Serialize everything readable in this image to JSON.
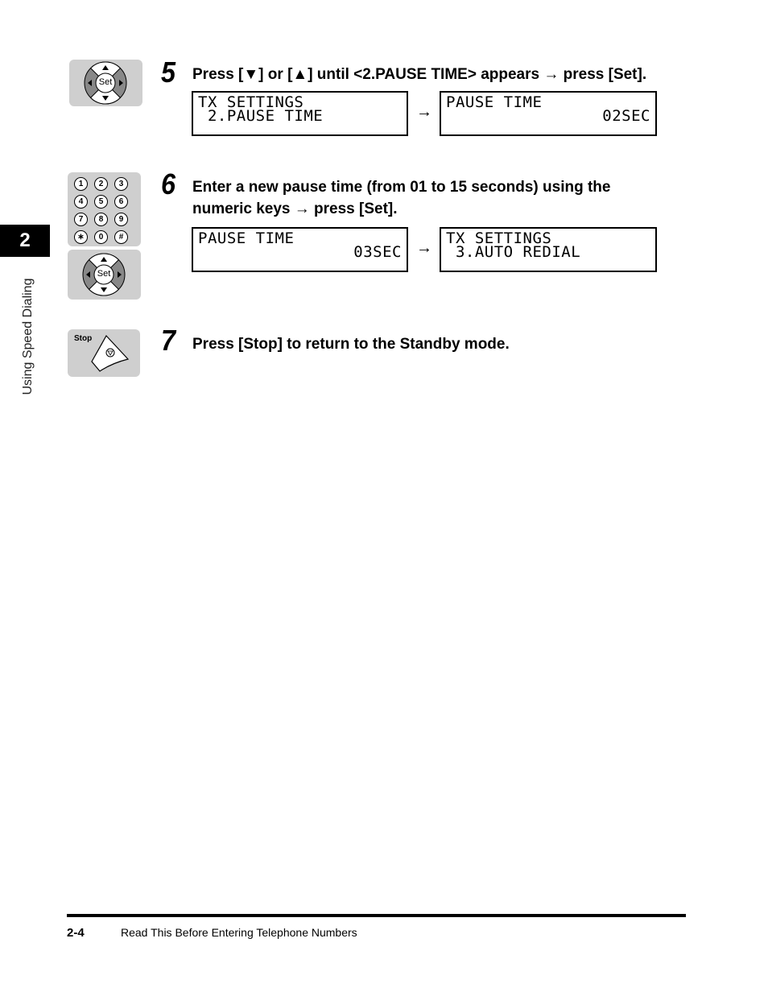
{
  "sidebar": {
    "chapter_number": "2",
    "chapter_title": "Using Speed Dialing"
  },
  "steps": [
    {
      "number": "5",
      "text": "Press [▼] or [▲] until <2.PAUSE TIME> appears → press [Set].",
      "key_icons": [
        "set-dpad"
      ],
      "displays": [
        {
          "line1": "TX SETTINGS",
          "line2": " 2.PAUSE TIME"
        },
        {
          "line1": "PAUSE TIME",
          "line2": "02SEC"
        }
      ],
      "arrow": "→"
    },
    {
      "number": "6",
      "text_line1": "Enter a new pause time (from 01 to 15 seconds) using the",
      "text_line2": "numeric keys → press [Set].",
      "key_icons": [
        "numeric-keypad",
        "set-dpad"
      ],
      "displays": [
        {
          "line1": "PAUSE TIME",
          "line2": "03SEC"
        },
        {
          "line1": "TX SETTINGS",
          "line2": " 3.AUTO REDIAL"
        }
      ],
      "arrow": "→"
    },
    {
      "number": "7",
      "text": "Press [Stop] to return to the Standby mode.",
      "key_icons": [
        "stop-key"
      ]
    }
  ],
  "keys": {
    "set_label": "Set",
    "stop_label": "Stop",
    "numeric": [
      "1",
      "2",
      "3",
      "4",
      "5",
      "6",
      "7",
      "8",
      "9",
      "∗",
      "0",
      "#"
    ]
  },
  "footer": {
    "page_number": "2-4",
    "section_title": "Read This Before Entering Telephone Numbers"
  }
}
